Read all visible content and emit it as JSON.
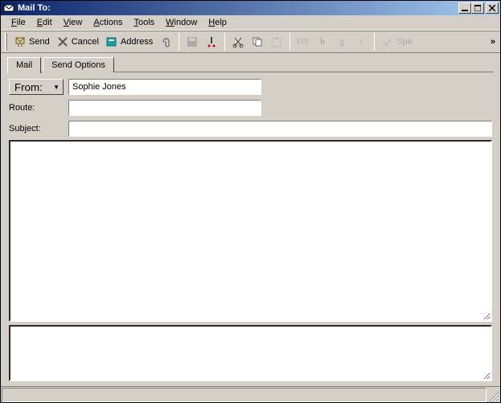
{
  "window": {
    "title": "Mail To:"
  },
  "menubar": {
    "file": "File",
    "edit": "Edit",
    "view": "View",
    "actions": "Actions",
    "tools": "Tools",
    "window": "Window",
    "help": "Help"
  },
  "toolbar": {
    "send": "Send",
    "cancel": "Cancel",
    "address": "Address",
    "spell": "Spe"
  },
  "tabs": {
    "mail": "Mail",
    "send_options": "Send Options"
  },
  "form": {
    "from_label": "From:",
    "from_value": "Sophie Jones",
    "route_label": "Route:",
    "route_value": "",
    "subject_label": "Subject:",
    "subject_value": ""
  },
  "body": {
    "text": "",
    "attachments": ""
  }
}
